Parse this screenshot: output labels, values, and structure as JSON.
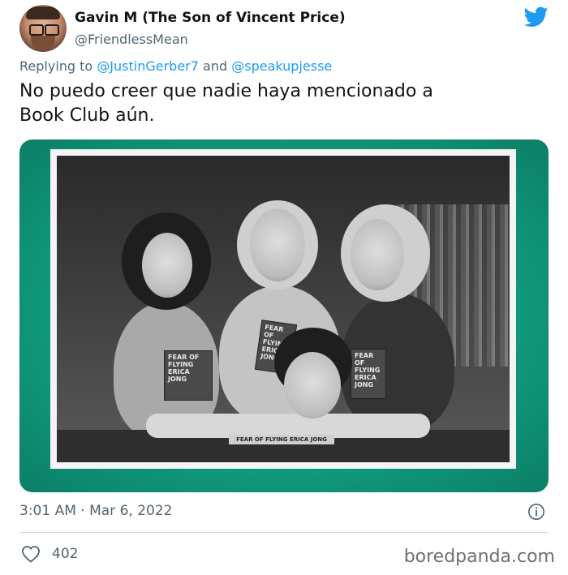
{
  "tweet": {
    "author_name": "Gavin M (The Son of Vincent Price)",
    "author_handle": "@FriendlessMean",
    "reply_prefix": "Replying to",
    "reply_user_1": "@JustinGerber7",
    "reply_conjunction": "and",
    "reply_user_2": "@speakupjesse",
    "text_line_1": "No puedo creer que nadie haya mencionado a",
    "text_line_2": "Book Club aún.",
    "timestamp": "3:01 AM · Mar 6, 2022",
    "like_count": "402"
  },
  "media": {
    "book_cover_1": "FEAR OF FLYING ERICA JONG",
    "book_cover_2": "FEAR OF FLYING ERICA JONG",
    "book_cover_3": "FEAR OF FLYING ERICA JONG",
    "book_spine": "FEAR OF FLYING ERICA JONG"
  },
  "watermark": "boredpanda.com",
  "icons": {
    "logo": "twitter-bird-icon",
    "info": "info-icon",
    "like": "heart-icon"
  },
  "colors": {
    "twitter_blue": "#1d9bf0",
    "secondary_text": "#536471",
    "media_background": "#109a7c"
  }
}
